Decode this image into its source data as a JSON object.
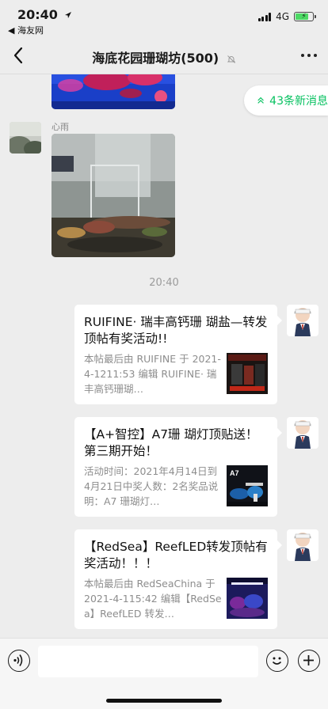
{
  "status_bar": {
    "time": "20:40",
    "back_app": "◀ 海友网",
    "network": "4G"
  },
  "nav": {
    "title": "海底花园珊瑚坊(500)",
    "back_icon": "chevron-left-icon",
    "mute_icon": "bell-slash-icon",
    "more_icon": "more-icon"
  },
  "new_messages": {
    "label": "43条新消息",
    "icon": "double-chevron-up-icon"
  },
  "messages": [
    {
      "type": "image",
      "sender": "",
      "description": "aquarium-photo"
    },
    {
      "type": "image",
      "sender": "心雨",
      "description": "aquarium-photo"
    }
  ],
  "time_divider": "20:40",
  "cards": [
    {
      "title": "RUIFINE· 瑞丰高钙珊 瑚盐—转发顶帖有奖活动!!",
      "desc": "本帖最后由 RUIFINE 于 2021-4-1211:53 编辑 RUIFINE· 瑞丰高钙珊瑚…"
    },
    {
      "title": "【A+智控】A7珊 瑚灯顶贴送！ 第三期开始！",
      "desc": "活动时间：2021年4月14日到4月21日中奖人数：2名奖品说明：A7 珊瑚灯…",
      "thumb_label": "A7"
    },
    {
      "title": "【RedSea】ReefLED转发顶帖有奖活动！！！",
      "desc": "本帖最后由 RedSeaChina 于 2021-4-115:42 编辑【RedSea】ReefLED 转发…"
    }
  ],
  "input_bar": {
    "voice_icon": "voice-icon",
    "emoji_icon": "emoji-icon",
    "plus_icon": "plus-icon"
  }
}
